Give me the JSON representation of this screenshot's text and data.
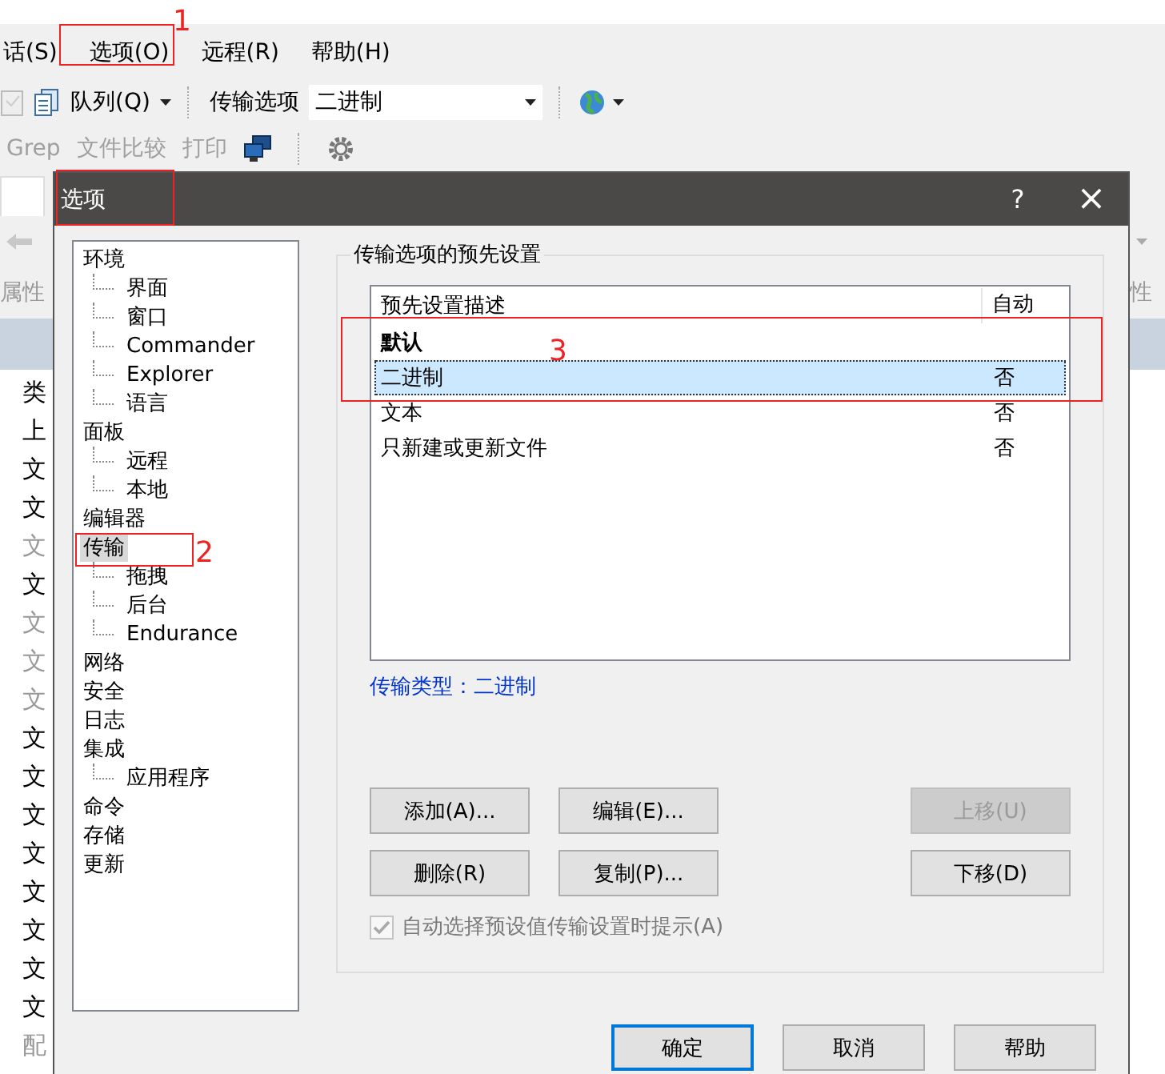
{
  "menu": [
    {
      "label": "话(S)"
    },
    {
      "label": "选项(O)"
    },
    {
      "label": "远程(R)"
    },
    {
      "label": "帮助(H)"
    }
  ],
  "toolbar": {
    "queue_label": "队列(Q)",
    "transfer_label": "传输选项",
    "transfer_value": "二进制"
  },
  "toolbar2": [
    {
      "label": "Grep",
      "disabled": true
    },
    {
      "label": "文件比较",
      "disabled": true
    },
    {
      "label": "打印",
      "disabled": true
    }
  ],
  "left_panel": {
    "properties_label": "属性",
    "header": "类",
    "items": [
      {
        "label": "上",
        "dim": false
      },
      {
        "label": "文",
        "dim": false
      },
      {
        "label": "文",
        "dim": false
      },
      {
        "label": "文",
        "dim": true
      },
      {
        "label": "文",
        "dim": false
      },
      {
        "label": "文",
        "dim": true
      },
      {
        "label": "文",
        "dim": true
      },
      {
        "label": "文",
        "dim": true
      },
      {
        "label": "文",
        "dim": false
      },
      {
        "label": "文",
        "dim": false
      },
      {
        "label": "文",
        "dim": false
      },
      {
        "label": "文",
        "dim": false
      },
      {
        "label": "文",
        "dim": false
      },
      {
        "label": "文",
        "dim": false
      },
      {
        "label": "文",
        "dim": false
      },
      {
        "label": "文",
        "dim": false
      },
      {
        "label": "配",
        "dim": true
      }
    ]
  },
  "right_panel": {
    "properties_label": "性"
  },
  "dialog": {
    "title": "选项",
    "title_marked": true,
    "help_glyph": "?",
    "close_glyph": "×",
    "tree": [
      {
        "label": "环境",
        "selected": false,
        "children": [
          {
            "label": "界面",
            "selected": false
          },
          {
            "label": "窗口",
            "selected": false
          },
          {
            "label": "Commander",
            "selected": false
          },
          {
            "label": "Explorer",
            "selected": false
          },
          {
            "label": "语言",
            "selected": false
          }
        ]
      },
      {
        "label": "面板",
        "selected": false,
        "children": [
          {
            "label": "远程",
            "selected": false
          },
          {
            "label": "本地",
            "selected": false
          }
        ]
      },
      {
        "label": "编辑器",
        "selected": false
      },
      {
        "label": "传输",
        "selected": true,
        "children": [
          {
            "label": "拖拽",
            "selected": false
          },
          {
            "label": "后台",
            "selected": false
          },
          {
            "label": "Endurance",
            "selected": false
          }
        ]
      },
      {
        "label": "网络",
        "selected": false
      },
      {
        "label": "安全",
        "selected": false
      },
      {
        "label": "日志",
        "selected": false
      },
      {
        "label": "集成",
        "selected": false,
        "children": [
          {
            "label": "应用程序",
            "selected": false
          }
        ]
      },
      {
        "label": "命令",
        "selected": false
      },
      {
        "label": "存储",
        "selected": false
      },
      {
        "label": "更新",
        "selected": false
      }
    ],
    "group_title": "传输选项的预先设置",
    "columns": [
      "预先设置描述",
      "自动"
    ],
    "rows": [
      {
        "name": "默认",
        "auto": "",
        "bold": true,
        "selected": false
      },
      {
        "name": "二进制",
        "auto": "否",
        "bold": false,
        "selected": true
      },
      {
        "name": "文本",
        "auto": "否",
        "bold": false,
        "selected": false
      },
      {
        "name": "只新建或更新文件",
        "auto": "否",
        "bold": false,
        "selected": false
      }
    ],
    "transfer_type_link": "传输类型：二进制",
    "buttons": [
      {
        "label": "添加(A)...",
        "disabled": false
      },
      {
        "label": "编辑(E)...",
        "disabled": false
      },
      {
        "label": "上移(U)",
        "disabled": true
      },
      {
        "label": "删除(R)",
        "disabled": false
      },
      {
        "label": "复制(P)...",
        "disabled": false
      },
      {
        "label": "下移(D)",
        "disabled": false
      }
    ],
    "checkbox": {
      "label": "自动选择预设值传输设置时提示(A)",
      "checked": true,
      "disabled": true
    },
    "footer_buttons": [
      {
        "label": "确定",
        "default": true
      },
      {
        "label": "取消",
        "default": false
      },
      {
        "label": "帮助",
        "default": false
      }
    ]
  },
  "annotations": [
    {
      "label": "1"
    },
    {
      "label": "2"
    },
    {
      "label": "3"
    }
  ]
}
